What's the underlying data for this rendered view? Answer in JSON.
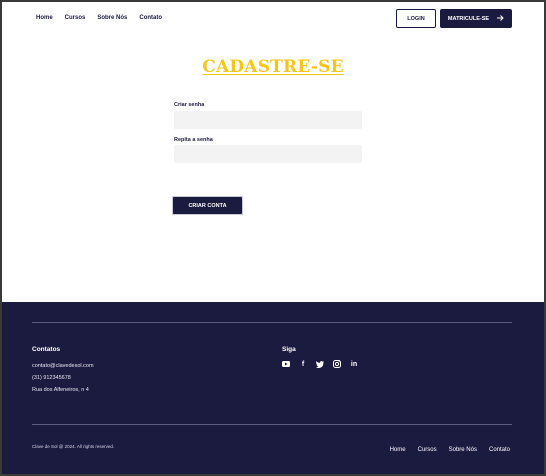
{
  "nav": {
    "links": [
      "Home",
      "Cursos",
      "Sobre Nós",
      "Contato"
    ],
    "login_label": "LOGIN",
    "matricule_label": "MATRICULE-SE",
    "matricule_icon": "arrow-right-icon"
  },
  "main": {
    "title": "CADASTRE-SE",
    "fields": [
      {
        "label": "Criar senha",
        "value": "",
        "placeholder": ""
      },
      {
        "label": "Repita a senha",
        "value": "",
        "placeholder": ""
      }
    ],
    "submit_label": "CRIAR CONTA"
  },
  "footer": {
    "contacts_heading": "Contatos",
    "contacts": [
      "contato@clavedesol.com",
      "(31) 912345678",
      "Rua dos Alfeneiros, n 4"
    ],
    "follow_heading": "Siga",
    "social_icons": [
      "youtube-icon",
      "facebook-icon",
      "twitter-icon",
      "instagram-icon",
      "linkedin-icon"
    ],
    "copyright": "Clave de Sol @ 2024. All rights reserved.",
    "links": [
      "Home",
      "Cursos",
      "Sobre Nós",
      "Contato"
    ]
  },
  "colors": {
    "navy": "#1b1a3f",
    "accent_yellow": "#f5c518",
    "input_bg": "#f3f3f3"
  }
}
